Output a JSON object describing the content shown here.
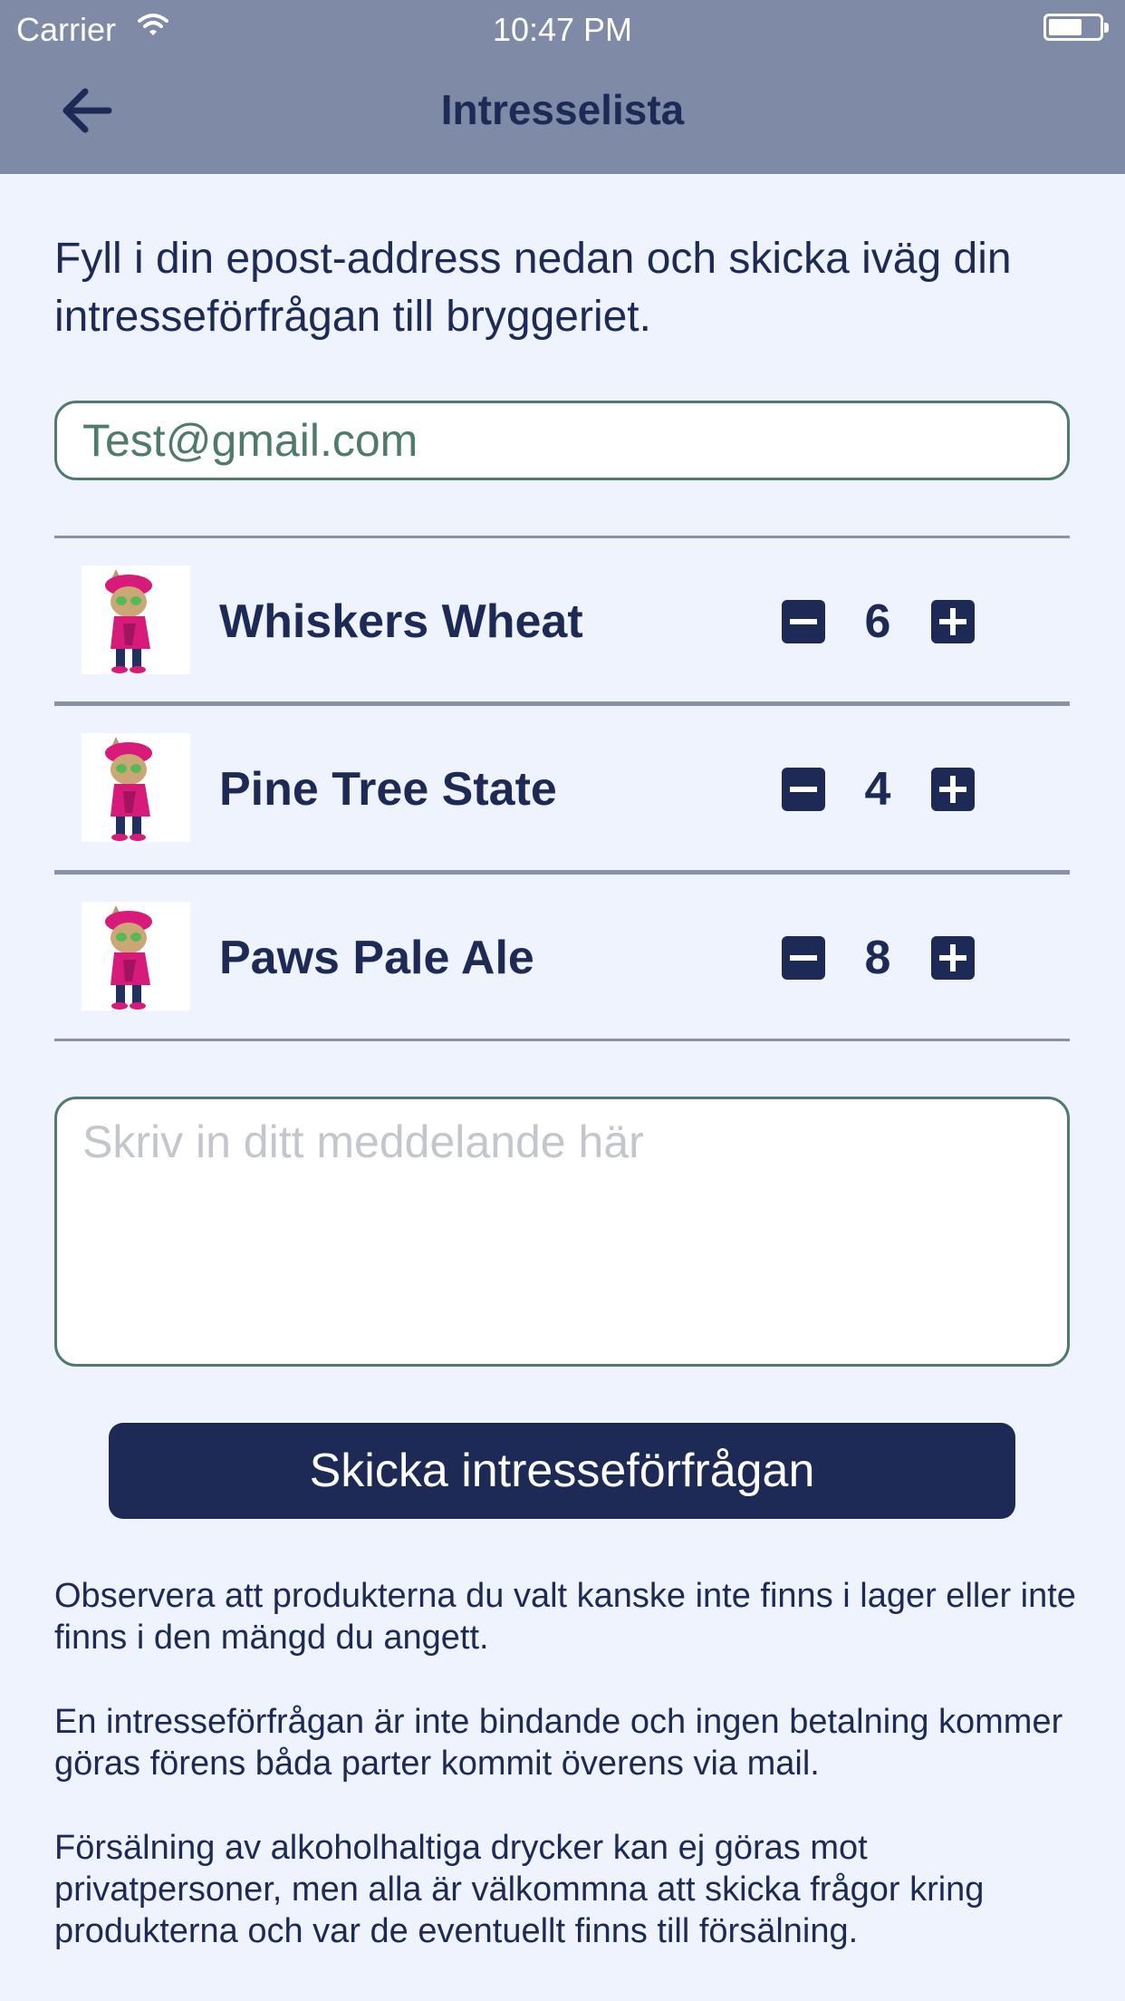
{
  "status_bar": {
    "carrier": "Carrier",
    "time": "10:47 PM"
  },
  "nav": {
    "title": "Intresselista",
    "back_icon": "arrow-left-icon"
  },
  "intro_text": "Fyll i din epost-address nedan och skicka iväg din intresseförfrågan till bryggeriet.",
  "email": {
    "value": "Test@gmail.com"
  },
  "items": [
    {
      "name": "Whiskers Wheat",
      "quantity": "6",
      "image_icon": "cat-mascot-image"
    },
    {
      "name": "Pine Tree State",
      "quantity": "4",
      "image_icon": "cat-mascot-image"
    },
    {
      "name": "Paws Pale Ale",
      "quantity": "8",
      "image_icon": "cat-mascot-image"
    }
  ],
  "message": {
    "placeholder": "Skriv in ditt meddelande här",
    "value": ""
  },
  "submit_label": "Skicka intresseförfrågan",
  "notes": [
    "Observera att produkterna du valt kanske inte finns i lager eller inte finns i den mängd du angett.",
    "En intresseförfrågan är inte bindande och ingen betalning kommer göras förens båda parter kommit överens via mail.",
    "Försälning av alkoholhaltiga drycker kan ej göras mot privatpersoner, men alla är välkommna att skicka frågor kring produkterna och var de eventuellt finns till försälning."
  ],
  "colors": {
    "navbar": "#7e8aa6",
    "background": "#eef3fd",
    "primary": "#1d2a55",
    "field_border": "#4f7a6c"
  }
}
